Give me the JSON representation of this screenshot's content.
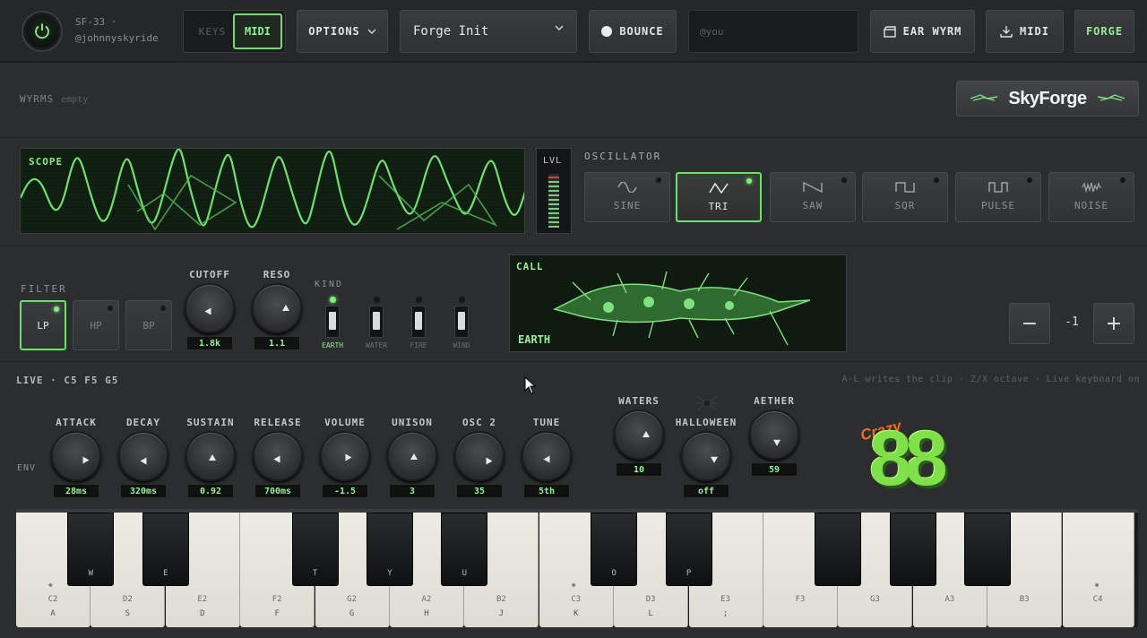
{
  "header": {
    "device": "SF-33 ·",
    "handle": "@johnnyskyride",
    "keys_label": "KEYS",
    "midi_toggle_label": "MIDI",
    "options_label": "OPTIONS",
    "preset_name": "Forge Init",
    "bounce_label": "BOUNCE",
    "user_placeholder": "@you",
    "ear_wyrm_label": "EAR WYRM",
    "midi_download_label": "MIDI",
    "forge_label": "FORGE",
    "accent_color": "#6be06b"
  },
  "wyrms": {
    "label": "WYRMS",
    "status": "empty",
    "logo_text": "SkyForge"
  },
  "scope": {
    "label": "SCOPE",
    "level_label": "LVL"
  },
  "oscillator": {
    "title": "OSCILLATOR",
    "selected": "TRI",
    "waves": [
      {
        "label": "SINE",
        "icon": "sine-wave-icon"
      },
      {
        "label": "TRI",
        "icon": "triangle-wave-icon"
      },
      {
        "label": "SAW",
        "icon": "saw-wave-icon"
      },
      {
        "label": "SQR",
        "icon": "square-wave-icon"
      },
      {
        "label": "PULSE",
        "icon": "pulse-wave-icon"
      },
      {
        "label": "NOISE",
        "icon": "noise-wave-icon"
      }
    ]
  },
  "filter": {
    "title": "FILTER",
    "types": [
      "LP",
      "HP",
      "BP"
    ],
    "selected": "LP",
    "cutoff": {
      "label": "CUTOFF",
      "value": "1.8k"
    },
    "reso": {
      "label": "RESO",
      "value": "1.1"
    },
    "kind_title": "KIND",
    "kinds": [
      "EARTH",
      "WATER",
      "FIRE",
      "WIND"
    ],
    "kind_selected": "EARTH"
  },
  "call": {
    "label": "CALL",
    "element": "EARTH"
  },
  "stepper": {
    "minus": "−",
    "value": "-1",
    "plus": "+"
  },
  "live": {
    "title": "LIVE · C5 F5 G5",
    "hint": "A-L writes the clip · Z/X octave · Live keyboard on",
    "env_label": "ENV"
  },
  "knobs": [
    {
      "label": "ATTACK",
      "value": "28ms"
    },
    {
      "label": "DECAY",
      "value": "320ms"
    },
    {
      "label": "SUSTAIN",
      "value": "0.92"
    },
    {
      "label": "RELEASE",
      "value": "700ms"
    },
    {
      "label": "VOLUME",
      "value": "-1.5"
    },
    {
      "label": "UNISON",
      "value": "3"
    },
    {
      "label": "OSC 2",
      "value": "35"
    },
    {
      "label": "TUNE",
      "value": "5th"
    },
    {
      "label": "WATERS",
      "value": "10"
    },
    {
      "label": "HALLOWEEN",
      "value": "off"
    },
    {
      "label": "AETHER",
      "value": "59"
    }
  ],
  "sticker": {
    "top": "Crazy",
    "bottom": "88"
  },
  "keyboard": {
    "white_keys": [
      {
        "note": "C2",
        "key": "A"
      },
      {
        "note": "D2",
        "key": "S"
      },
      {
        "note": "E2",
        "key": "D"
      },
      {
        "note": "F2",
        "key": "F"
      },
      {
        "note": "G2",
        "key": "G"
      },
      {
        "note": "A2",
        "key": "H"
      },
      {
        "note": "B2",
        "key": "J"
      },
      {
        "note": "C3",
        "key": "K"
      },
      {
        "note": "D3",
        "key": "L"
      },
      {
        "note": "E3",
        "key": ";"
      },
      {
        "note": "F3",
        "key": ""
      },
      {
        "note": "G3",
        "key": ""
      },
      {
        "note": "A3",
        "key": ""
      },
      {
        "note": "B3",
        "key": ""
      },
      {
        "note": "C4",
        "key": ""
      }
    ],
    "black_keys": [
      "W",
      "E",
      "T",
      "Y",
      "U",
      "O",
      "P",
      "",
      "",
      ""
    ]
  }
}
